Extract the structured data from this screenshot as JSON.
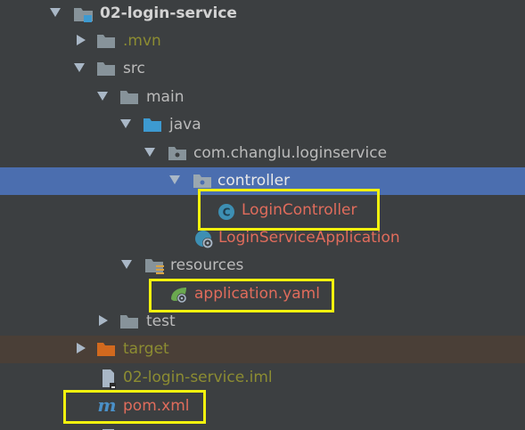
{
  "tree": {
    "items": [
      {
        "label": "02-login-service",
        "color": "#d3d3d3",
        "expanded": true,
        "icon": "module-folder-icon"
      },
      {
        "label": ".mvn",
        "color": "#8c8c32",
        "expanded": false,
        "icon": "folder-icon"
      },
      {
        "label": "src",
        "color": "#bbbbbb",
        "expanded": true,
        "icon": "folder-icon"
      },
      {
        "label": "main",
        "color": "#bbbbbb",
        "expanded": true,
        "icon": "folder-icon"
      },
      {
        "label": "java",
        "color": "#bbbbbb",
        "expanded": true,
        "icon": "source-folder-icon"
      },
      {
        "label": "com.changlu.loginservice",
        "color": "#bbbbbb",
        "expanded": true,
        "icon": "package-icon"
      },
      {
        "label": "controller",
        "color": "#e8e8e8",
        "expanded": true,
        "icon": "package-icon",
        "selected": true
      },
      {
        "label": "LoginController",
        "color": "#e06c5c",
        "icon": "class-icon"
      },
      {
        "label": "LoginServiceApplication",
        "color": "#e06c5c",
        "icon": "spring-boot-class-icon"
      },
      {
        "label": "resources",
        "color": "#bbbbbb",
        "expanded": true,
        "icon": "resources-folder-icon"
      },
      {
        "label": "application.yaml",
        "color": "#e06c5c",
        "icon": "spring-config-icon"
      },
      {
        "label": "test",
        "color": "#bbbbbb",
        "expanded": false,
        "icon": "folder-icon"
      },
      {
        "label": "target",
        "color": "#8c8c32",
        "expanded": false,
        "icon": "excluded-folder-icon",
        "excluded": true
      },
      {
        "label": "02-login-service.iml",
        "color": "#8c8c32",
        "icon": "iml-file-icon"
      },
      {
        "label": "pom.xml",
        "color": "#e06c5c",
        "icon": "maven-icon"
      }
    ]
  },
  "colors": {
    "background": "#3c3f41",
    "selection": "#4b6eaf",
    "excluded_row": "#4a3f37",
    "highlight": "#f2f20e",
    "modified": "#e06c5c",
    "ignored": "#8c8c32"
  }
}
